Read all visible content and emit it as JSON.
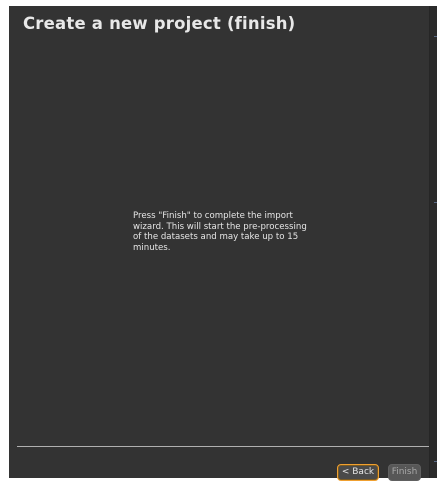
{
  "dialog": {
    "title": "Create a new project (finish)",
    "message": "Press \"Finish\" to complete the import\nwizard. This will start the pre-processing\nof the datasets and may take up to 15\nminutes."
  },
  "buttons": {
    "back_label": "< Back",
    "finish_label": "Finish"
  },
  "colors": {
    "background": "#333333",
    "focus_outline": "#f0a030"
  }
}
